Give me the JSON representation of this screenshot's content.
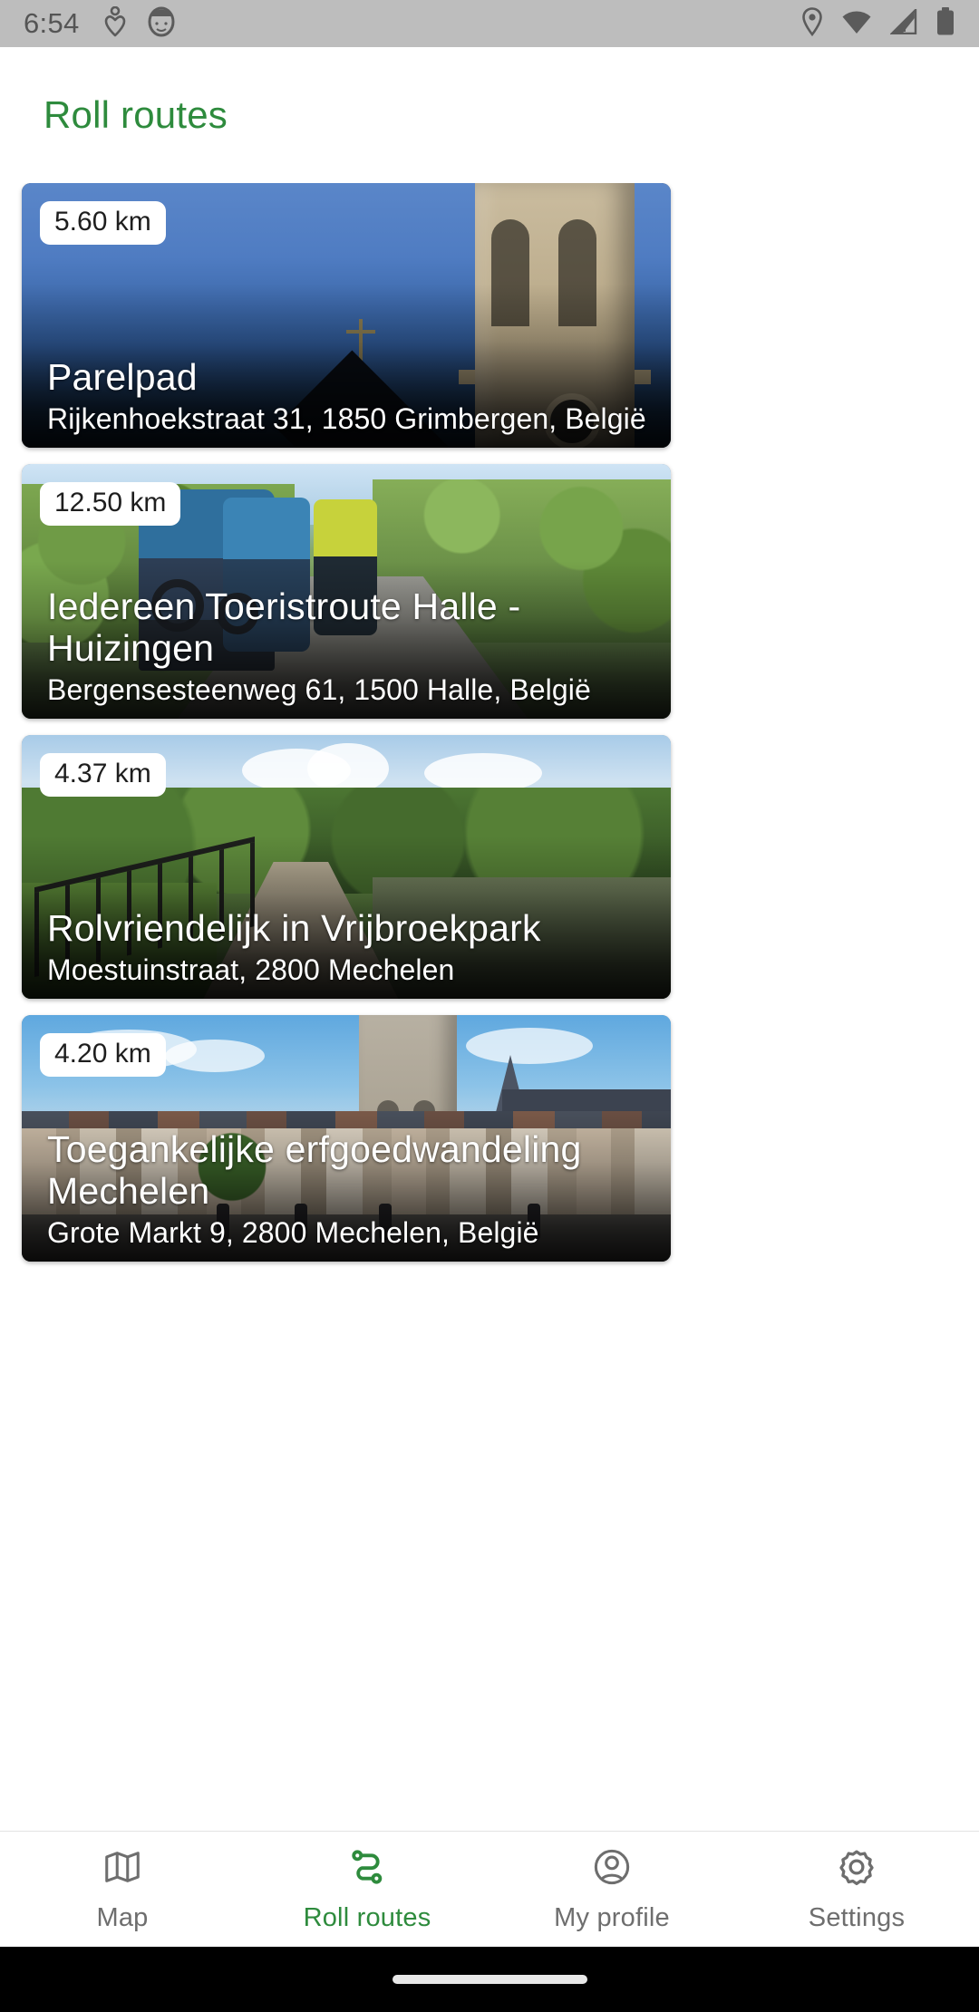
{
  "status_bar": {
    "time": "6:54",
    "left_icons": [
      "heart-pulse-icon",
      "avatar-badge-icon"
    ],
    "right_icons": [
      "location-pin-icon",
      "wifi-icon",
      "cellular-signal-icon",
      "battery-icon"
    ],
    "background": "#bdbdbd"
  },
  "app_bar": {
    "title": "Roll routes",
    "title_color": "#2e8b3d"
  },
  "routes": [
    {
      "distance": "5.60 km",
      "title": "Parelpad",
      "address": "Rijkenhoekstraat 31, 1850 Grimbergen, België",
      "photo": "church-tower-blue-sky-photo"
    },
    {
      "distance": "12.50 km",
      "title": "Iedereen Toeristroute Halle - Huizingen",
      "address": "Bergensesteenweg 61, 1500 Halle, België",
      "photo": "handcycle-riders-greenway-photo"
    },
    {
      "distance": "4.37 km",
      "title": "Rolvriendelijk in Vrijbroekpark",
      "address": "Moestuinstraat, 2800 Mechelen",
      "photo": "canal-path-railing-photo"
    },
    {
      "distance": "4.20 km",
      "title": "Toegankelijke erfgoedwandeling Mechelen",
      "address": "Grote Markt 9, 2800 Mechelen, België",
      "photo": "mechelen-grote-markt-photo"
    }
  ],
  "bottom_nav": {
    "active_color": "#2e8b3d",
    "inactive_color": "#6e6e6e",
    "items": [
      {
        "label": "Map",
        "icon": "map-icon",
        "active": false
      },
      {
        "label": "Roll routes",
        "icon": "route-icon",
        "active": true
      },
      {
        "label": "My profile",
        "icon": "account-circle-icon",
        "active": false
      },
      {
        "label": "Settings",
        "icon": "gear-icon",
        "active": false
      }
    ]
  }
}
